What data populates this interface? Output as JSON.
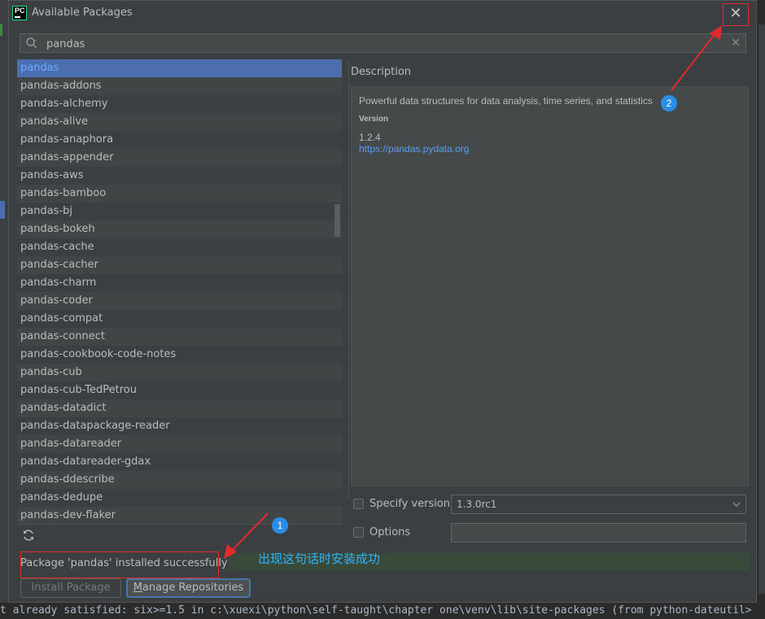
{
  "dialog": {
    "title": "Available Packages",
    "app_logo_text": "PC",
    "close_icon": "close-icon"
  },
  "search": {
    "value": "pandas",
    "placeholder": ""
  },
  "packages": [
    "pandas",
    "pandas-addons",
    "pandas-alchemy",
    "pandas-alive",
    "pandas-anaphora",
    "pandas-appender",
    "pandas-aws",
    "pandas-bamboo",
    "pandas-bj",
    "pandas-bokeh",
    "pandas-cache",
    "pandas-cacher",
    "pandas-charm",
    "pandas-coder",
    "pandas-compat",
    "pandas-connect",
    "pandas-cookbook-code-notes",
    "pandas-cub",
    "pandas-cub-TedPetrou",
    "pandas-datadict",
    "pandas-datapackage-reader",
    "pandas-datareader",
    "pandas-datareader-gdax",
    "pandas-ddescribe",
    "pandas-dedupe",
    "pandas-dev-flaker"
  ],
  "selected_package": "pandas",
  "description": {
    "label": "Description",
    "text": "Powerful data structures for data analysis, time series, and statistics",
    "version_heading": "Version",
    "version_value": "1.2.4",
    "homepage": "https://pandas.pydata.org"
  },
  "options": {
    "specify_version_label": "Specify version",
    "specify_version_checked": false,
    "version_selected": "1.3.0rc1",
    "options_label": "Options",
    "options_checked": false,
    "options_value": ""
  },
  "status": {
    "message": "Package 'pandas' installed successfully"
  },
  "annotation": {
    "text": "出现这句话时安装成功",
    "badge_1": "1",
    "badge_2": "2"
  },
  "buttons": {
    "install_label": "Install Package",
    "manage_label_underlined": "M",
    "manage_label_rest": "anage Repositories"
  },
  "console": {
    "line": "t already satisfied: six>=1.5 in c:\\xuexi\\python\\self-taught\\chapter one\\venv\\lib\\site-packages (from python-dateutil>"
  },
  "colors": {
    "accent": "#4b6eaf",
    "link": "#589df6",
    "annotation_red": "#e32b2b",
    "annotation_blue": "#2a8ee8"
  }
}
